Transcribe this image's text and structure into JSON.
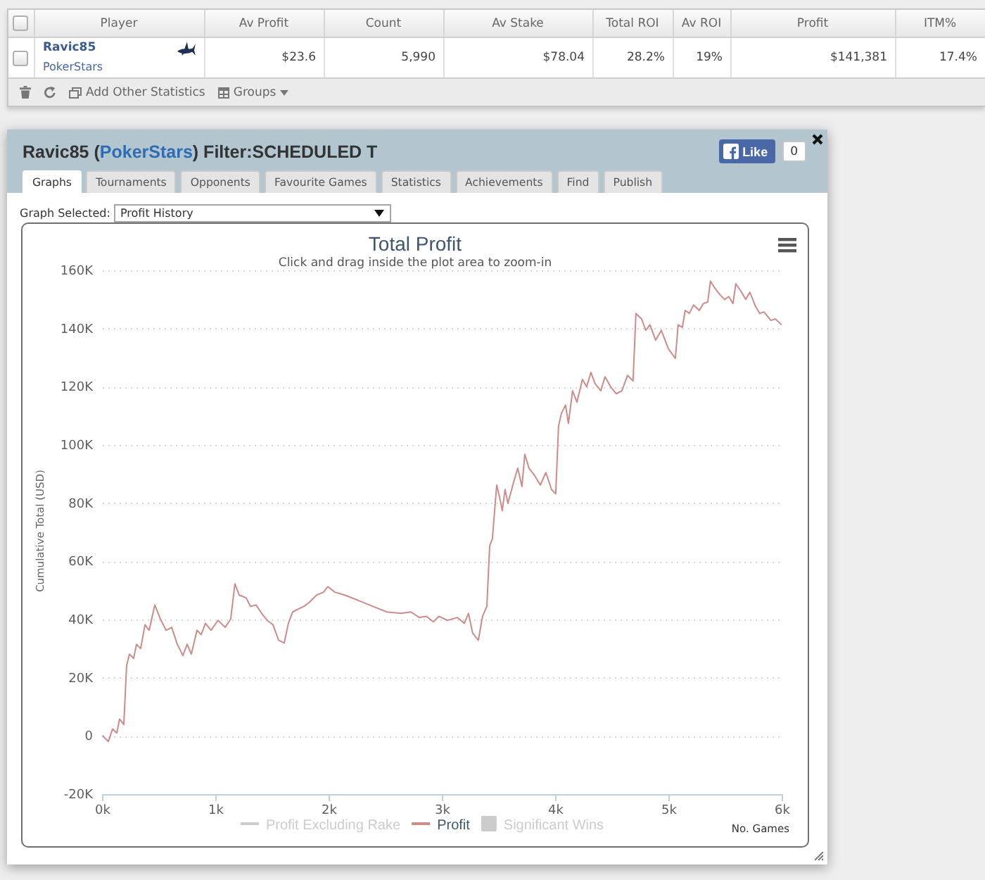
{
  "stats_table": {
    "select_all": {
      "checked": false
    },
    "columns": [
      "Player",
      "Av Profit",
      "Count",
      "Av Stake",
      "Total ROI",
      "Av ROI",
      "Profit",
      "ITM%"
    ],
    "rows": [
      {
        "checked": false,
        "cells": [
          {
            "player": "Ravic85",
            "site": "PokerStars"
          },
          "$23.6",
          "5,990",
          "$78.04",
          "28.2%",
          "19%",
          "$141,381",
          "17.4%"
        ]
      }
    ],
    "toolbar": {
      "add_statistics": "Add Other Statistics",
      "groups": "Groups"
    }
  },
  "dialog": {
    "title_prefix": "Ravic85 (",
    "title_link": "PokerStars",
    "title_suffix": ") Filter:SCHEDULED T",
    "like_label": "Like",
    "like_count": "0",
    "tabs": [
      {
        "label": "Graphs",
        "selected": true
      },
      {
        "label": "Tournaments",
        "selected": false
      },
      {
        "label": "Opponents",
        "selected": false
      },
      {
        "label": "Favourite Games",
        "selected": false
      },
      {
        "label": "Statistics",
        "selected": false
      },
      {
        "label": "Achievements",
        "selected": false
      },
      {
        "label": "Find",
        "selected": false
      },
      {
        "label": "Publish",
        "selected": false
      }
    ],
    "graph_selector": {
      "label": "Graph Selected:",
      "value": "Profit History"
    },
    "chart": {
      "subtitle": "Click and drag inside the plot area to zoom-in",
      "legend": [
        {
          "label": "Profit Excluding Rake",
          "kind": "line",
          "visible": false
        },
        {
          "label": "Profit",
          "kind": "line",
          "visible": true,
          "color": "#cd8c8a"
        },
        {
          "label": "Significant Wins",
          "kind": "area",
          "visible": false
        }
      ],
      "chart_data": {
        "type": "line",
        "title": "Total Profit",
        "xlabel": "No. Games",
        "ylabel": "Cumulative Total (USD)",
        "grid": true,
        "x": [
          0,
          50,
          87,
          124,
          149,
          186,
          211,
          236,
          273,
          298,
          335,
          373,
          410,
          460,
          509,
          559,
          609,
          658,
          708,
          745,
          782,
          832,
          869,
          907,
          956,
          1018,
          1081,
          1130,
          1167,
          1205,
          1267,
          1304,
          1354,
          1403,
          1453,
          1503,
          1553,
          1602,
          1639,
          1677,
          1726,
          1776,
          1826,
          1888,
          1950,
          1987,
          2049,
          2136,
          2260,
          2385,
          2509,
          2633,
          2720,
          2795,
          2857,
          2919,
          2968,
          3043,
          3130,
          3192,
          3229,
          3266,
          3316,
          3353,
          3391,
          3416,
          3440,
          3478,
          3502,
          3527,
          3552,
          3577,
          3627,
          3664,
          3701,
          3726,
          3763,
          3813,
          3863,
          3912,
          3962,
          3999,
          4024,
          4049,
          4086,
          4111,
          4148,
          4186,
          4235,
          4272,
          4310,
          4347,
          4397,
          4434,
          4484,
          4533,
          4583,
          4633,
          4682,
          4707,
          4757,
          4794,
          4831,
          4881,
          4931,
          4993,
          5055,
          5080,
          5117,
          5142,
          5179,
          5216,
          5266,
          5303,
          5341,
          5365,
          5403,
          5452,
          5490,
          5527,
          5564,
          5589,
          5639,
          5676,
          5713,
          5763,
          5800,
          5837,
          5899,
          5937,
          5990
        ],
        "series": [
          {
            "color": "#cd8c8a",
            "values": [
              0,
              -1900,
              2400,
              1000,
              5800,
              3900,
              24200,
              28100,
              26600,
              31500,
              30000,
              38200,
              36300,
              45000,
              40200,
              36300,
              37300,
              31500,
              27600,
              31500,
              28100,
              36300,
              34800,
              38700,
              36300,
              39700,
              37300,
              40200,
              52300,
              48400,
              47400,
              44500,
              45000,
              42100,
              39700,
              38200,
              32900,
              31900,
              38700,
              42600,
              43600,
              44500,
              46000,
              48400,
              49400,
              51300,
              49400,
              48400,
              46500,
              44500,
              42600,
              42100,
              42600,
              40700,
              41100,
              39200,
              41100,
              39700,
              40700,
              38700,
              42100,
              35300,
              32900,
              41100,
              44500,
              65300,
              67800,
              86200,
              82300,
              77400,
              84700,
              79900,
              87100,
              92000,
              85700,
              96800,
              92000,
              89500,
              86200,
              90500,
              84700,
              83200,
              106500,
              110800,
              113700,
              107400,
              118600,
              114700,
              122500,
              120000,
              124900,
              121000,
              118600,
              123400,
              120000,
              117600,
              118600,
              123900,
              122000,
              145200,
              143300,
              139400,
              141300,
              136000,
              139400,
              133100,
              129700,
              141300,
              140400,
              146200,
              145200,
              148100,
              146200,
              148600,
              149100,
              156300,
              153900,
              151500,
              150000,
              151000,
              148600,
              155400,
              152500,
              150000,
              152500,
              147600,
              145200,
              145700,
              142800,
              143300,
              141400
            ]
          }
        ],
        "xlim": [
          0,
          6000
        ],
        "ylim": [
          -20000,
          160000
        ],
        "xticks": [
          {
            "value": 0,
            "label": "0k"
          },
          {
            "value": 1000,
            "label": "1k"
          },
          {
            "value": 2000,
            "label": "2k"
          },
          {
            "value": 3000,
            "label": "3k"
          },
          {
            "value": 4000,
            "label": "4k"
          },
          {
            "value": 5000,
            "label": "5k"
          },
          {
            "value": 6000,
            "label": "6k"
          }
        ],
        "yticks": [
          {
            "value": -20000,
            "label": "-20K"
          },
          {
            "value": 0,
            "label": "0"
          },
          {
            "value": 20000,
            "label": "20K"
          },
          {
            "value": 40000,
            "label": "40K"
          },
          {
            "value": 60000,
            "label": "60K"
          },
          {
            "value": 80000,
            "label": "80K"
          },
          {
            "value": 100000,
            "label": "100K"
          },
          {
            "value": 120000,
            "label": "120K"
          },
          {
            "value": 140000,
            "label": "140K"
          },
          {
            "value": 160000,
            "label": "160K"
          }
        ]
      }
    }
  }
}
